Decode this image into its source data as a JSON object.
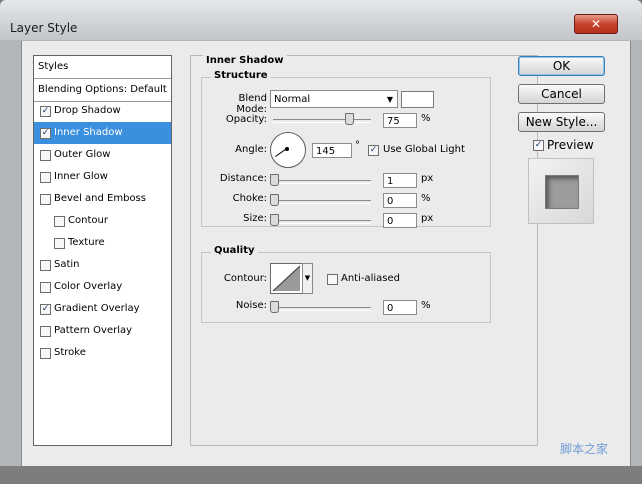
{
  "window": {
    "title": "Layer Style",
    "close_glyph": "✕"
  },
  "styles": {
    "header": "Styles",
    "blending": "Blending Options: Default",
    "items": [
      {
        "label": "Drop Shadow",
        "checked": true,
        "sub": false,
        "selected": false
      },
      {
        "label": "Inner Shadow",
        "checked": true,
        "sub": false,
        "selected": true
      },
      {
        "label": "Outer Glow",
        "checked": false,
        "sub": false,
        "selected": false
      },
      {
        "label": "Inner Glow",
        "checked": false,
        "sub": false,
        "selected": false
      },
      {
        "label": "Bevel and Emboss",
        "checked": false,
        "sub": false,
        "selected": false
      },
      {
        "label": "Contour",
        "checked": false,
        "sub": true,
        "selected": false
      },
      {
        "label": "Texture",
        "checked": false,
        "sub": true,
        "selected": false
      },
      {
        "label": "Satin",
        "checked": false,
        "sub": false,
        "selected": false
      },
      {
        "label": "Color Overlay",
        "checked": false,
        "sub": false,
        "selected": false
      },
      {
        "label": "Gradient Overlay",
        "checked": true,
        "sub": false,
        "selected": false
      },
      {
        "label": "Pattern Overlay",
        "checked": false,
        "sub": false,
        "selected": false
      },
      {
        "label": "Stroke",
        "checked": false,
        "sub": false,
        "selected": false
      }
    ]
  },
  "panel": {
    "title": "Inner Shadow",
    "structure": {
      "title": "Structure",
      "blend_mode_label": "Blend Mode:",
      "blend_mode_value": "Normal",
      "opacity_label": "Opacity:",
      "opacity_value": "75",
      "opacity_unit": "%",
      "angle_label": "Angle:",
      "angle_value": "145",
      "angle_unit": "°",
      "global_light_label": "Use Global Light",
      "global_light_checked": true,
      "distance_label": "Distance:",
      "distance_value": "1",
      "distance_unit": "px",
      "choke_label": "Choke:",
      "choke_value": "0",
      "choke_unit": "%",
      "size_label": "Size:",
      "size_value": "0",
      "size_unit": "px"
    },
    "quality": {
      "title": "Quality",
      "contour_label": "Contour:",
      "antialiased_label": "Anti-aliased",
      "antialiased_checked": false,
      "noise_label": "Noise:",
      "noise_value": "0",
      "noise_unit": "%"
    }
  },
  "buttons": {
    "ok": "OK",
    "cancel": "Cancel",
    "new_style": "New Style...",
    "preview_label": "Preview",
    "preview_checked": true
  },
  "watermark": "脚本之家",
  "colors": {
    "selection": "#3b8fdf",
    "shadow_color": "#ffffff"
  }
}
